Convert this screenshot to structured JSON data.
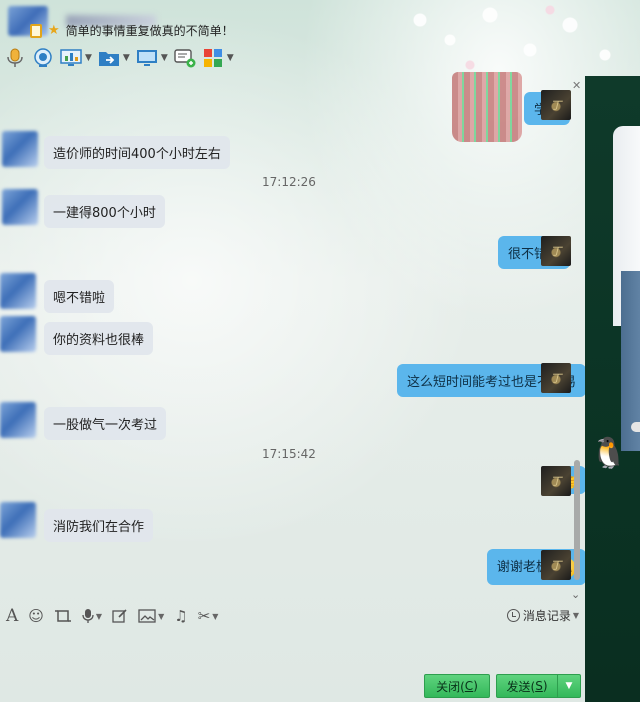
{
  "header": {
    "signature": "简单的事情重复做真的不简单！",
    "toolbar": [
      {
        "icon": "microphone-icon",
        "has_menu": false
      },
      {
        "icon": "webcam-icon",
        "has_menu": false
      },
      {
        "icon": "screen-share-icon",
        "has_menu": true
      },
      {
        "icon": "send-file-icon",
        "has_menu": true
      },
      {
        "icon": "remote-desktop-icon",
        "has_menu": true
      },
      {
        "icon": "new-discussion-icon",
        "has_menu": false
      },
      {
        "icon": "apps-icon",
        "has_menu": true
      }
    ]
  },
  "messages": [
    {
      "side": "right",
      "text": "学霸"
    },
    {
      "side": "left",
      "text": "造价师的时间400个小时左右"
    },
    {
      "side": "time",
      "text": "17:12:26"
    },
    {
      "side": "left",
      "text": "一建得800个小时"
    },
    {
      "side": "right",
      "text": "很不错了"
    },
    {
      "side": "left",
      "text": "嗯不错啦"
    },
    {
      "side": "left",
      "text": "你的资料也很棒"
    },
    {
      "side": "right",
      "text": "这么短时间能考过也是不容易"
    },
    {
      "side": "left",
      "text": "一股做气一次考过"
    },
    {
      "side": "time",
      "text": "17:15:42"
    },
    {
      "side": "right",
      "text": "",
      "emoji": "thumbs-up"
    },
    {
      "side": "left",
      "text": "消防我们在合作"
    },
    {
      "side": "right",
      "text": "谢谢老板",
      "emoji": "smile"
    }
  ],
  "input_toolbar": {
    "history_label": "消息记录"
  },
  "buttons": {
    "close_label": "关闭(C)",
    "close_prefix": "关闭(",
    "close_key": "C",
    "close_suffix": ")",
    "send_prefix": "发送(",
    "send_key": "S",
    "send_suffix": ")"
  },
  "colors": {
    "outgoing_bubble": "#5bb6ec",
    "incoming_bubble": "#e0e6ec",
    "button_green": "#33b85a",
    "side_panel": "#0f3a2a"
  }
}
